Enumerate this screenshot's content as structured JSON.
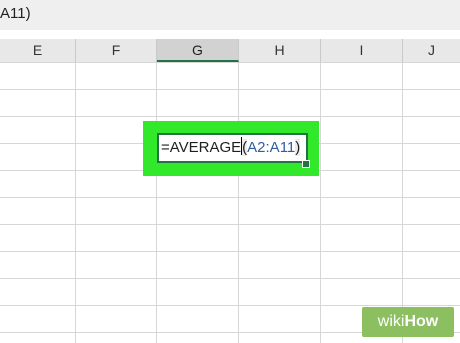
{
  "formula_bar": {
    "text": "A11)"
  },
  "columns": [
    {
      "label": "E",
      "active": false
    },
    {
      "label": "F",
      "active": false
    },
    {
      "label": "G",
      "active": true
    },
    {
      "label": "H",
      "active": false
    },
    {
      "label": "I",
      "active": false
    },
    {
      "label": "J",
      "active": false
    }
  ],
  "active_cell": {
    "column": "G",
    "formula_prefix": "=AVERAGE",
    "open_paren": "(",
    "reference": "A2:A11",
    "close_paren": ")"
  },
  "highlight_color": "#31e82a",
  "watermark": {
    "part1": "wiki",
    "part2": "How"
  }
}
